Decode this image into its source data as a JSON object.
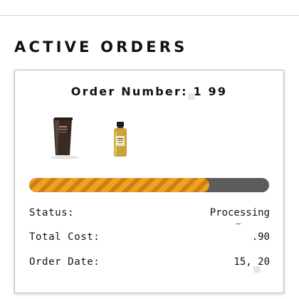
{
  "page": {
    "title": "ACTIVE ORDERS"
  },
  "order": {
    "number_label": "Order Number:",
    "number_value": "1 99",
    "products": [
      {
        "name": "tube",
        "icon": "product-tube-image"
      },
      {
        "name": "bottle",
        "icon": "product-bottle-image"
      }
    ],
    "progress": 0.75,
    "colors": {
      "progress_fill": "#f1a01f",
      "progress_track": "#5c5c5c"
    },
    "details": [
      {
        "label": "Status:",
        "value": "Processing"
      },
      {
        "label": "Total Cost:",
        "value": ".90"
      },
      {
        "label": "Order Date:",
        "value": "15,  20"
      }
    ]
  }
}
